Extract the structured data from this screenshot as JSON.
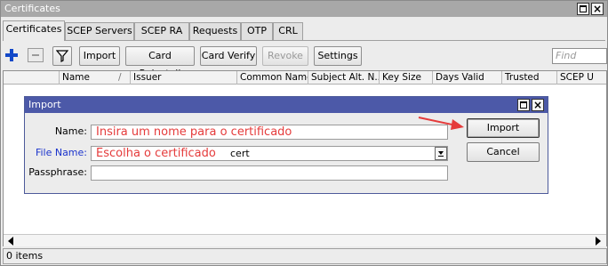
{
  "window": {
    "title": "Certificates"
  },
  "tabs": [
    {
      "label": "Certificates",
      "active": true
    },
    {
      "label": "SCEP Servers"
    },
    {
      "label": "SCEP RA"
    },
    {
      "label": "Requests"
    },
    {
      "label": "OTP"
    },
    {
      "label": "CRL"
    }
  ],
  "toolbar": {
    "add_icon": "plus-icon",
    "remove_icon": "minus-icon",
    "filter_icon": "filter-icon",
    "buttons": [
      {
        "label": "Import"
      },
      {
        "label": "Card Reinstall"
      },
      {
        "label": "Card Verify"
      },
      {
        "label": "Revoke",
        "disabled": true
      },
      {
        "label": "Settings"
      }
    ],
    "find_placeholder": "Find"
  },
  "table": {
    "columns": [
      "Name",
      "Issuer",
      "Common Name",
      "Subject Alt. N...",
      "Key Size",
      "Days Valid",
      "Trusted",
      "SCEP U"
    ],
    "sort_indicator": "/"
  },
  "status": {
    "items_text": "0 items"
  },
  "dialog": {
    "title": "Import",
    "name_label": "Name:",
    "name_hint": "Insira um nome para o certificado",
    "file_label": "File Name:",
    "file_hint": "Escolha o certificado",
    "file_value": "cert",
    "pass_label": "Passphrase:",
    "import_label": "Import",
    "cancel_label": "Cancel"
  },
  "colors": {
    "dialog_title_bg": "#4c59a8",
    "annotation_red": "#e53b3b",
    "file_label_blue": "#1a33cc",
    "add_icon_blue": "#1248c8"
  }
}
